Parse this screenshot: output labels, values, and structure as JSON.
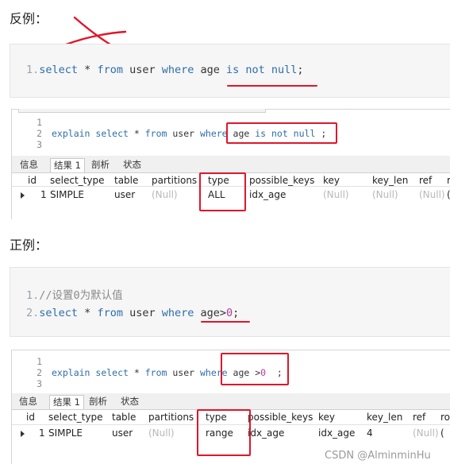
{
  "bad_example": {
    "heading": "反例：",
    "code_lines": [
      {
        "num": "1.",
        "parts": [
          {
            "t": "select",
            "c": "kw"
          },
          {
            "t": " * ",
            "c": "tx"
          },
          {
            "t": "from",
            "c": "kw"
          },
          {
            "t": " user ",
            "c": "tx"
          },
          {
            "t": "where",
            "c": "kw"
          },
          {
            "t": " age ",
            "c": "tx"
          },
          {
            "t": "is not null",
            "c": "kw"
          },
          {
            "t": ";",
            "c": "tx"
          }
        ]
      }
    ],
    "editor": {
      "line_numbers": [
        "1",
        "2",
        "3"
      ],
      "query_parts": [
        {
          "t": "explain ",
          "c": "kw"
        },
        {
          "t": "select",
          "c": "kw"
        },
        {
          "t": " * ",
          "c": "tx"
        },
        {
          "t": "from",
          "c": "kw"
        },
        {
          "t": " user ",
          "c": "tx"
        },
        {
          "t": "where",
          "c": "kw"
        },
        {
          "t": " age ",
          "c": "tx"
        },
        {
          "t": "is not null",
          "c": "kw"
        },
        {
          "t": " ;",
          "c": "tx"
        }
      ]
    },
    "tabs": [
      "信息",
      "结果 1",
      "剖析",
      "状态"
    ],
    "columns": [
      "id",
      "select_type",
      "table",
      "partitions",
      "type",
      "possible_keys",
      "key",
      "key_len",
      "ref",
      "r"
    ],
    "row": [
      "1",
      "SIMPLE",
      "user",
      "(Null)",
      "ALL",
      "idx_age",
      "(Null)",
      "(Null)",
      "(Null)",
      "("
    ]
  },
  "good_example": {
    "heading": "正例：",
    "code_lines": [
      {
        "num": "1.",
        "parts": [
          {
            "t": "//设置0为默认值",
            "c": "cm"
          }
        ]
      },
      {
        "num": "2.",
        "parts": [
          {
            "t": "select",
            "c": "kw"
          },
          {
            "t": " * ",
            "c": "tx"
          },
          {
            "t": "from",
            "c": "kw"
          },
          {
            "t": " user ",
            "c": "tx"
          },
          {
            "t": "where",
            "c": "kw"
          },
          {
            "t": " age>",
            "c": "tx"
          },
          {
            "t": "0",
            "c": "num"
          },
          {
            "t": ";",
            "c": "tx"
          }
        ]
      }
    ],
    "editor": {
      "line_numbers": [
        "1",
        "2",
        "3"
      ],
      "query_parts": [
        {
          "t": "explain ",
          "c": "kw"
        },
        {
          "t": "select",
          "c": "kw"
        },
        {
          "t": " * ",
          "c": "tx"
        },
        {
          "t": "from",
          "c": "kw"
        },
        {
          "t": " user ",
          "c": "tx"
        },
        {
          "t": "where",
          "c": "kw"
        },
        {
          "t": " age >",
          "c": "tx"
        },
        {
          "t": "0",
          "c": "num"
        },
        {
          "t": "  ;",
          "c": "tx"
        }
      ]
    },
    "tabs": [
      "信息",
      "结果 1",
      "剖析",
      "状态"
    ],
    "columns": [
      "id",
      "select_type",
      "table",
      "partitions",
      "type",
      "possible_keys",
      "key",
      "key_len",
      "ref",
      "row"
    ],
    "row": [
      "1",
      "SIMPLE",
      "user",
      "(Null)",
      "range",
      "idx_age",
      "idx_age",
      "4",
      "(Null)",
      "("
    ]
  },
  "watermark": "CSDN @AlminminHu",
  "colors": {
    "annotation_red": "#e0162a",
    "keyword_blue": "#2d6ea8",
    "number_magenta": "#b43a9a"
  }
}
